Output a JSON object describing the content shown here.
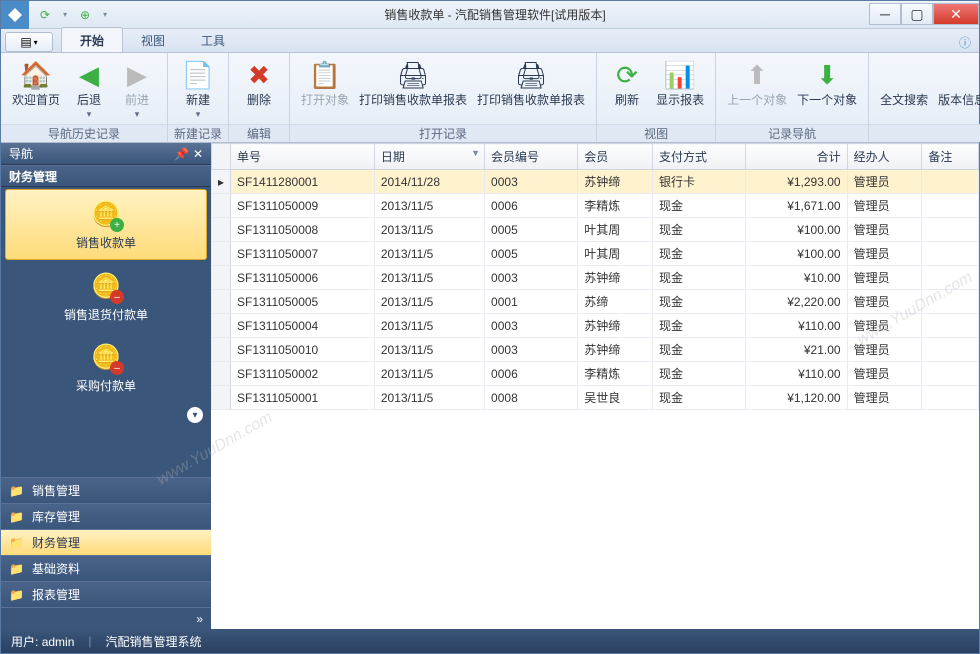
{
  "window": {
    "title": "销售收款单 - 汽配销售管理软件[试用版本]"
  },
  "tabs": {
    "start": "开始",
    "view": "视图",
    "tools": "工具"
  },
  "ribbon": {
    "welcome": "欢迎首页",
    "back": "后退",
    "forward": "前进",
    "new": "新建",
    "delete": "删除",
    "open_object": "打开对象",
    "print_report_single": "打印销售收款单报表",
    "print_report_list": "打印销售收款单报表",
    "refresh": "刷新",
    "show_report": "显示报表",
    "prev": "上一个对象",
    "next": "下一个对象",
    "fulltext": "全文搜索",
    "version": "版本信息",
    "grp_nav_history": "导航历史记录",
    "grp_new": "新建记录",
    "grp_edit": "编辑",
    "grp_open": "打开记录",
    "grp_view": "视图",
    "grp_recnav": "记录导航"
  },
  "navbar": {
    "title": "导航",
    "section": "财务管理",
    "items": [
      {
        "label": "销售收款单"
      },
      {
        "label": "销售退货付款单"
      },
      {
        "label": "采购付款单"
      }
    ],
    "groups": [
      "销售管理",
      "库存管理",
      "财务管理",
      "基础资料",
      "报表管理"
    ]
  },
  "grid": {
    "columns": [
      "单号",
      "日期",
      "会员编号",
      "会员",
      "支付方式",
      "合计",
      "经办人",
      "备注"
    ],
    "rows": [
      {
        "no": "SF1411280001",
        "date": "2014/11/28",
        "memid": "0003",
        "member": "苏钟缔",
        "pay": "银行卡",
        "total": "¥1,293.00",
        "op": "管理员",
        "remark": ""
      },
      {
        "no": "SF1311050009",
        "date": "2013/11/5",
        "memid": "0006",
        "member": "李精炼",
        "pay": "现金",
        "total": "¥1,671.00",
        "op": "管理员",
        "remark": ""
      },
      {
        "no": "SF1311050008",
        "date": "2013/11/5",
        "memid": "0005",
        "member": "叶其周",
        "pay": "现金",
        "total": "¥100.00",
        "op": "管理员",
        "remark": ""
      },
      {
        "no": "SF1311050007",
        "date": "2013/11/5",
        "memid": "0005",
        "member": "叶其周",
        "pay": "现金",
        "total": "¥100.00",
        "op": "管理员",
        "remark": ""
      },
      {
        "no": "SF1311050006",
        "date": "2013/11/5",
        "memid": "0003",
        "member": "苏钟缔",
        "pay": "现金",
        "total": "¥10.00",
        "op": "管理员",
        "remark": ""
      },
      {
        "no": "SF1311050005",
        "date": "2013/11/5",
        "memid": "0001",
        "member": "苏缔",
        "pay": "现金",
        "total": "¥2,220.00",
        "op": "管理员",
        "remark": ""
      },
      {
        "no": "SF1311050004",
        "date": "2013/11/5",
        "memid": "0003",
        "member": "苏钟缔",
        "pay": "现金",
        "total": "¥110.00",
        "op": "管理员",
        "remark": ""
      },
      {
        "no": "SF1311050010",
        "date": "2013/11/5",
        "memid": "0003",
        "member": "苏钟缔",
        "pay": "现金",
        "total": "¥21.00",
        "op": "管理员",
        "remark": ""
      },
      {
        "no": "SF1311050002",
        "date": "2013/11/5",
        "memid": "0006",
        "member": "李精炼",
        "pay": "现金",
        "total": "¥110.00",
        "op": "管理员",
        "remark": ""
      },
      {
        "no": "SF1311050001",
        "date": "2013/11/5",
        "memid": "0008",
        "member": "吴世良",
        "pay": "现金",
        "total": "¥1,120.00",
        "op": "管理员",
        "remark": ""
      }
    ]
  },
  "statusbar": {
    "user_label": "用户:",
    "user": "admin",
    "sys": "汽配销售管理系统"
  },
  "watermark": "www.YuuDnn.com"
}
